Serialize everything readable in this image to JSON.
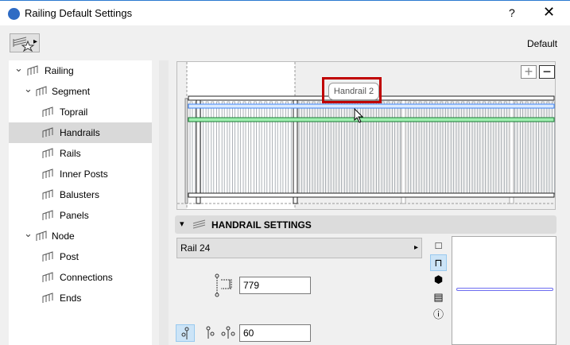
{
  "window": {
    "title": "Railing Default Settings",
    "help": "?",
    "close": "✕"
  },
  "toolbar": {
    "favorites_arrow": "▸",
    "default_label": "Default"
  },
  "tree": [
    {
      "label": "Railing",
      "level": 0,
      "chevron": "⌄"
    },
    {
      "label": "Segment",
      "level": 1,
      "chevron": "⌄"
    },
    {
      "label": "Toprail",
      "level": 2
    },
    {
      "label": "Handrails",
      "level": 2,
      "selected": true
    },
    {
      "label": "Rails",
      "level": 2
    },
    {
      "label": "Inner Posts",
      "level": 2
    },
    {
      "label": "Balusters",
      "level": 2
    },
    {
      "label": "Panels",
      "level": 2
    },
    {
      "label": "Node",
      "level": 1,
      "chevron": "⌄"
    },
    {
      "label": "Post",
      "level": 2
    },
    {
      "label": "Connections",
      "level": 2
    },
    {
      "label": "Ends",
      "level": 2
    }
  ],
  "preview": {
    "zoom_in": "+",
    "zoom_out": "−",
    "tooltip": "Handrail 2",
    "highlight_color": "#c00000",
    "selected_rail_color": "#3b82f6",
    "other_rail_color": "#9ff0b0"
  },
  "section": {
    "title": "HANDRAIL SETTINGS",
    "collapse": "▾"
  },
  "settings": {
    "profile": "Rail 24",
    "profile_arrow": "▸",
    "height_value": "779",
    "offset_value": "60"
  },
  "view_buttons": [
    "□",
    "⊓",
    "⬢",
    "▤",
    "ⓘ"
  ]
}
